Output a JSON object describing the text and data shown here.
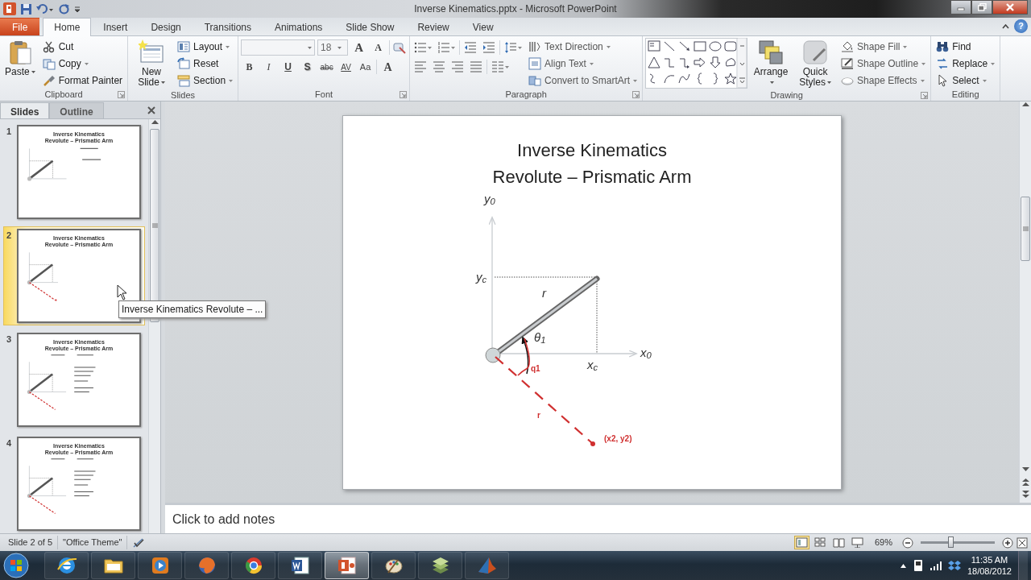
{
  "window": {
    "title": "Inverse Kinematics.pptx - Microsoft PowerPoint"
  },
  "ribbon_tabs": [
    {
      "label": "File",
      "kind": "file",
      "selected": false
    },
    {
      "label": "Home",
      "kind": "tab",
      "selected": true
    },
    {
      "label": "Insert",
      "kind": "tab",
      "selected": false
    },
    {
      "label": "Design",
      "kind": "tab",
      "selected": false
    },
    {
      "label": "Transitions",
      "kind": "tab",
      "selected": false
    },
    {
      "label": "Animations",
      "kind": "tab",
      "selected": false
    },
    {
      "label": "Slide Show",
      "kind": "tab",
      "selected": false
    },
    {
      "label": "Review",
      "kind": "tab",
      "selected": false
    },
    {
      "label": "View",
      "kind": "tab",
      "selected": false
    }
  ],
  "help": "?",
  "ribbon_groups": [
    {
      "kind": "clipboard",
      "label": "Clipboard",
      "launcher": true,
      "large": [
        {
          "label": "Paste",
          "dropdown": true
        }
      ],
      "small": [
        {
          "label": "Cut",
          "dropdown": false
        },
        {
          "label": "Copy",
          "dropdown": true
        },
        {
          "label": "Format Painter",
          "dropdown": false
        }
      ]
    },
    {
      "kind": "slides",
      "label": "Slides",
      "launcher": false,
      "large": [
        {
          "label": "New Slide",
          "dropdown": true
        }
      ],
      "small": [
        {
          "label": "Layout",
          "dropdown": true
        },
        {
          "label": "Reset",
          "dropdown": false
        },
        {
          "label": "Section",
          "dropdown": true
        }
      ]
    },
    {
      "kind": "font",
      "label": "Font",
      "launcher": true,
      "size": "18",
      "size_buttons": [
        "A",
        "A"
      ],
      "format_buttons": [
        "B",
        "I",
        "U",
        "S",
        "abc",
        "AV",
        "Aa"
      ],
      "color_button": "A"
    },
    {
      "kind": "paragraph",
      "label": "Paragraph",
      "launcher": true,
      "small": [
        {
          "label": "Text Direction",
          "dropdown": true
        },
        {
          "label": "Align Text",
          "dropdown": true
        },
        {
          "label": "Convert to SmartArt",
          "dropdown": true
        }
      ]
    },
    {
      "kind": "drawing",
      "label": "Drawing",
      "launcher": true,
      "large": [
        {
          "label": "Arrange",
          "dropdown": true
        },
        {
          "label": "Quick Styles",
          "dropdown": true
        }
      ],
      "small": [
        {
          "label": "Shape Fill",
          "dropdown": true
        },
        {
          "label": "Shape Outline",
          "dropdown": true
        },
        {
          "label": "Shape Effects",
          "dropdown": true
        }
      ]
    },
    {
      "kind": "editing",
      "label": "Editing",
      "launcher": false,
      "small": [
        {
          "label": "Find",
          "dropdown": false
        },
        {
          "label": "Replace",
          "dropdown": true
        },
        {
          "label": "Select",
          "dropdown": true
        }
      ]
    }
  ],
  "slides_panel": {
    "tabs": [
      {
        "label": "Slides",
        "selected": true
      },
      {
        "label": "Outline",
        "selected": false
      }
    ],
    "thumbnails": [
      {
        "number": "1",
        "selected": false,
        "kind": "formula",
        "title": [
          "Inverse Kinematics",
          "Revolute – Prismatic Arm"
        ]
      },
      {
        "number": "2",
        "selected": true,
        "kind": "red",
        "title": [
          "Inverse Kinematics",
          "Revolute – Prismatic Arm"
        ]
      },
      {
        "number": "3",
        "selected": false,
        "kind": "worked",
        "title": [
          "Inverse Kinematics",
          "Revolute – Prismatic Arm"
        ]
      },
      {
        "number": "4",
        "selected": false,
        "kind": "worked",
        "title": [
          "Inverse Kinematics",
          "Revolute – Prismatic Arm"
        ]
      }
    ],
    "tooltip": "Inverse Kinematics Revolute – ..."
  },
  "slide": {
    "title": [
      "Inverse Kinematics",
      "Revolute – Prismatic Arm"
    ],
    "labels": [
      {
        "text": "y$_{0}$",
        "kind": "math"
      },
      {
        "text": "y$_{c}$",
        "kind": "math"
      },
      {
        "text": "r",
        "kind": "math"
      },
      {
        "text": "θ$_{1}$",
        "kind": "math"
      },
      {
        "text": "x$_{0}$",
        "kind": "math"
      },
      {
        "text": "x$_{c}$",
        "kind": "math"
      },
      {
        "text": "q1",
        "kind": "note"
      },
      {
        "text": "r",
        "kind": "note"
      },
      {
        "text": "(x2, y2)",
        "kind": "note"
      }
    ]
  },
  "notes": {
    "placeholder": "Click to add notes"
  },
  "status_bar": {
    "slide": "Slide 2 of 5",
    "theme": "\"Office Theme\"",
    "views": [
      {
        "kind": "normal",
        "selected": true
      },
      {
        "kind": "sorter",
        "selected": false
      },
      {
        "kind": "reading",
        "selected": false
      },
      {
        "kind": "show",
        "selected": false
      }
    ],
    "zoom": "69%",
    "zoom_slider": {
      "level": 0.4
    }
  },
  "taskbar": {
    "apps": [
      {
        "kind": "browser",
        "selected": false
      },
      {
        "kind": "folder",
        "selected": false
      },
      {
        "kind": "media",
        "selected": false
      },
      {
        "kind": "globe",
        "selected": false
      },
      {
        "kind": "wheel",
        "selected": false
      },
      {
        "kind": "document",
        "selected": false
      },
      {
        "kind": "presentation",
        "selected": true
      },
      {
        "kind": "paint",
        "selected": false
      },
      {
        "kind": "stack",
        "selected": false
      },
      {
        "kind": "peak",
        "selected": false
      }
    ],
    "time": "11:35 AM",
    "date": "18/08/2012"
  }
}
